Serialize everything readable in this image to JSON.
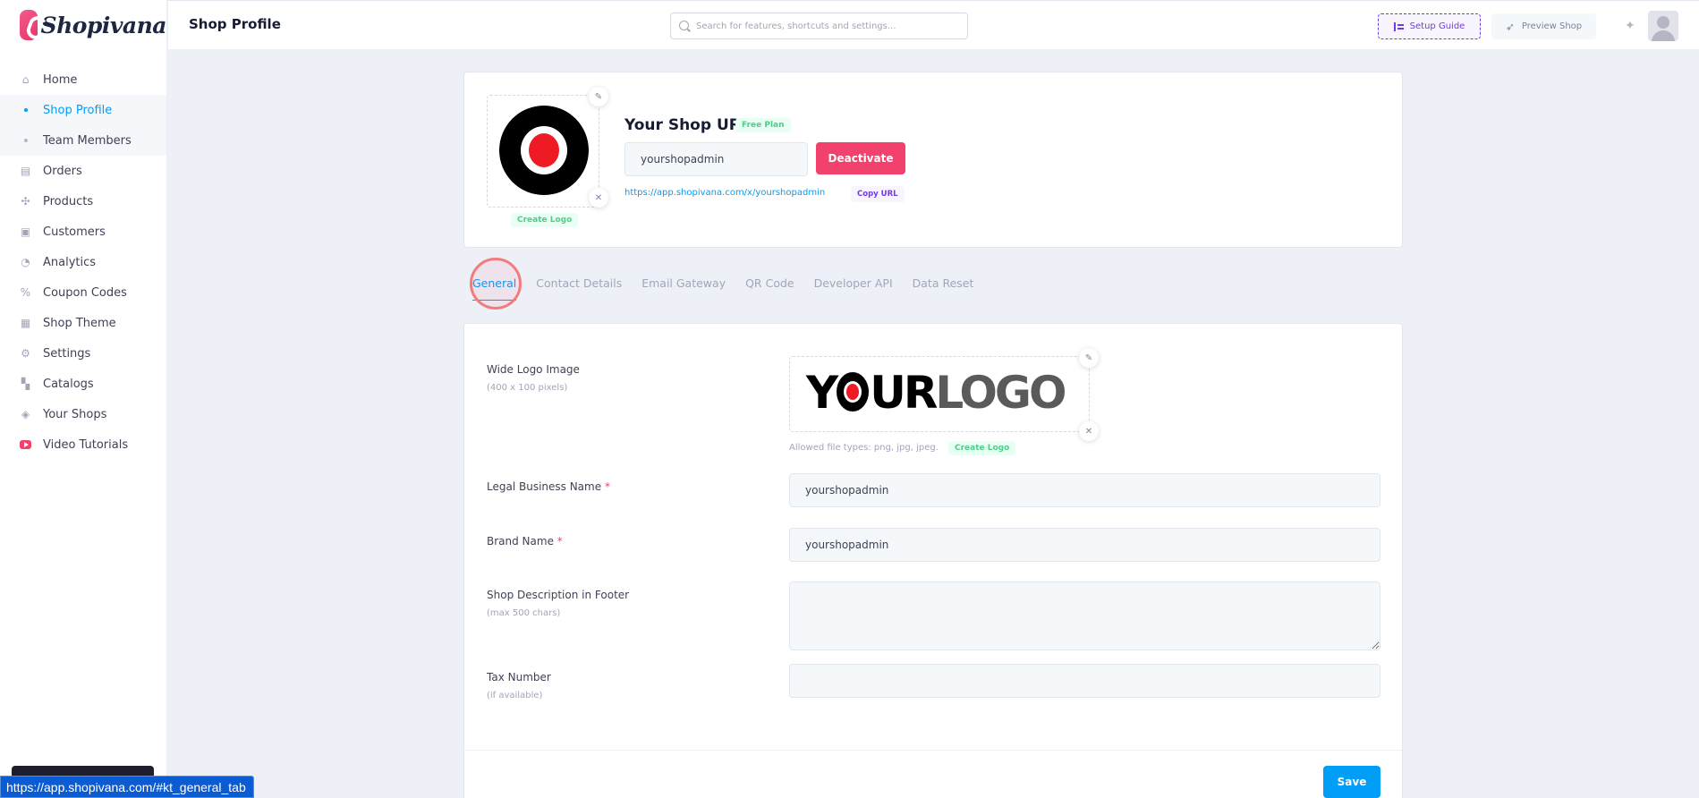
{
  "brand": {
    "name": "Shopivana"
  },
  "header": {
    "title": "Shop Profile",
    "search_placeholder": "Search for features, shortcuts and settings...",
    "setup_guide": "Setup Guide",
    "preview_shop": "Preview Shop"
  },
  "sidebar": {
    "items": [
      {
        "label": "Home"
      },
      {
        "label": "Shop Profile"
      },
      {
        "label": "Team Members"
      },
      {
        "label": "Orders"
      },
      {
        "label": "Products"
      },
      {
        "label": "Customers"
      },
      {
        "label": "Analytics"
      },
      {
        "label": "Coupon Codes"
      },
      {
        "label": "Shop Theme"
      },
      {
        "label": "Settings"
      },
      {
        "label": "Catalogs"
      },
      {
        "label": "Your Shops"
      },
      {
        "label": "Video Tutorials"
      }
    ]
  },
  "shop_card": {
    "create_logo": "Create Logo",
    "title": "Your Shop URL",
    "plan_badge": "Free Plan",
    "url_value": "yourshopadmin",
    "deactivate": "Deactivate",
    "link": "https://app.shopivana.com/x/yourshopadmin",
    "copy_url": "Copy URL"
  },
  "tabs": [
    {
      "label": "General"
    },
    {
      "label": "Contact Details"
    },
    {
      "label": "Email Gateway"
    },
    {
      "label": "QR Code"
    },
    {
      "label": "Developer API"
    },
    {
      "label": "Data Reset"
    }
  ],
  "form": {
    "wide_logo_label": "Wide Logo Image",
    "wide_logo_hint": "(400 x 100 pixels)",
    "wide_logo_text_dark": "Y",
    "wide_logo_text_dark2": "UR",
    "wide_logo_text_grey": "LOGO",
    "allowed_types": "Allowed file types: png, jpg, jpeg.",
    "create_logo": "Create Logo",
    "legal_name_label": "Legal Business Name",
    "legal_name_value": "yourshopadmin",
    "brand_name_label": "Brand Name",
    "brand_name_value": "yourshopadmin",
    "description_label": "Shop Description in Footer",
    "description_hint": "(max 500 chars)",
    "description_value": "",
    "tax_label": "Tax Number",
    "tax_hint": "(if available)",
    "tax_value": "",
    "required_mark": "*",
    "save": "Save"
  },
  "status_bar": {
    "url": "https://app.shopivana.com/#kt_general_tab"
  },
  "colors": {
    "primary": "#009ef7",
    "danger": "#f1416c",
    "success": "#50cd89",
    "purple": "#7239ea"
  }
}
